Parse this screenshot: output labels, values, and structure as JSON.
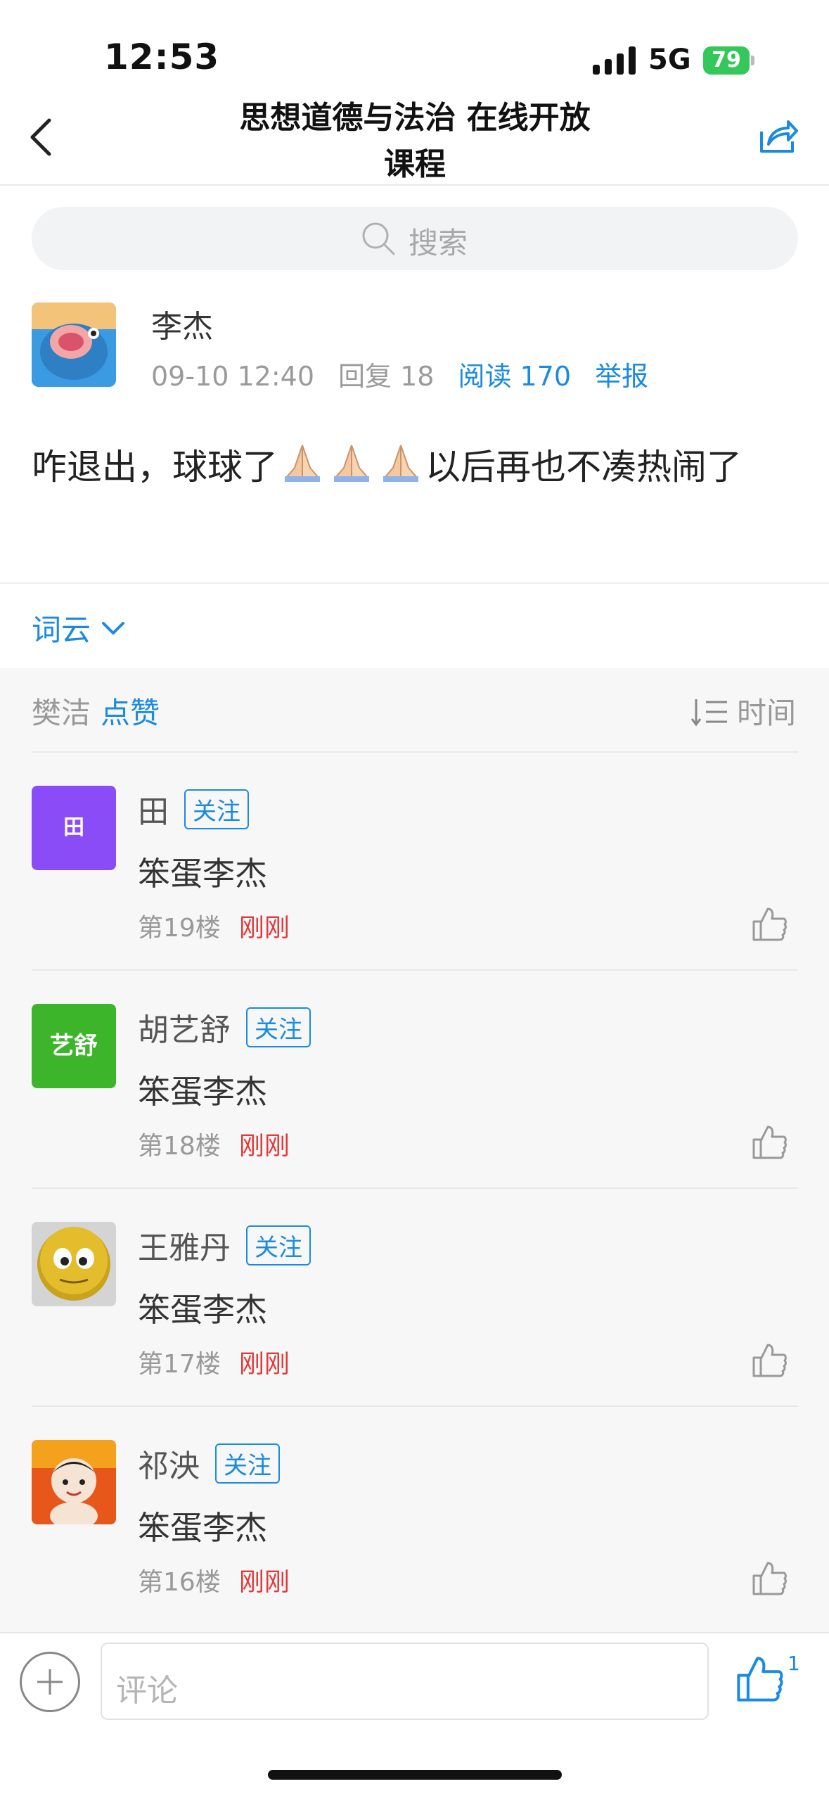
{
  "status_bar": {
    "time": "12:53",
    "network": "5G",
    "battery": "79"
  },
  "nav": {
    "title_line1": "思想道德与法治 在线开放",
    "title_line2": "课程"
  },
  "search": {
    "placeholder": "搜索"
  },
  "post": {
    "author": "李杰",
    "datetime": "09-10 12:40",
    "replies": "回复 18",
    "reads": "阅读 170",
    "report": "举报",
    "content_before": "咋退出，球球了",
    "content_after": "以后再也不凑热闹了",
    "emoji_icon": "folded-hands-emoji"
  },
  "word_cloud": {
    "label": "词云"
  },
  "likes": {
    "names": "樊洁",
    "action": "点赞"
  },
  "sort": {
    "label": "时间"
  },
  "comments": [
    {
      "name": "田",
      "follow": "关注",
      "text": "笨蛋李杰",
      "floor": "第19楼",
      "time": "刚刚",
      "avatar_text": "田",
      "avatar_color": "#8a4cf7"
    },
    {
      "name": "胡艺舒",
      "follow": "关注",
      "text": "笨蛋李杰",
      "floor": "第18楼",
      "time": "刚刚",
      "avatar_text": "艺舒",
      "avatar_color": "#3cb52b"
    },
    {
      "name": "王雅丹",
      "follow": "关注",
      "text": "笨蛋李杰",
      "floor": "第17楼",
      "time": "刚刚"
    },
    {
      "name": "祁泱",
      "follow": "关注",
      "text": "笨蛋李杰",
      "floor": "第16楼",
      "time": "刚刚"
    }
  ],
  "bottom_bar": {
    "placeholder": "评论",
    "like_count": "1"
  },
  "colors": {
    "accent": "#1a8be0",
    "time_red": "#e03a3a",
    "battery_green": "#34c759"
  }
}
